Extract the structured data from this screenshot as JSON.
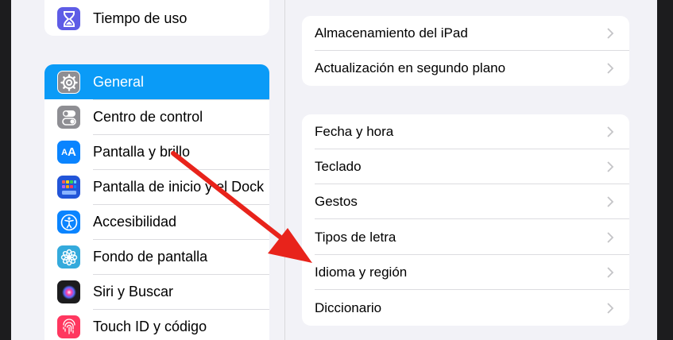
{
  "sidebar": {
    "top_item": {
      "label": "Tiempo de uso",
      "icon": "hourglass-icon",
      "color": "#5e5ce6"
    },
    "items": [
      {
        "label": "General",
        "icon": "gear-icon",
        "color": "#8e8e93",
        "selected": true
      },
      {
        "label": "Centro de control",
        "icon": "toggles-icon",
        "color": "#8e8e93"
      },
      {
        "label": "Pantalla y brillo",
        "icon": "text-size-icon",
        "color": "#0a84ff"
      },
      {
        "label": "Pantalla de inicio y el Dock",
        "icon": "app-grid-icon",
        "color": "#2255d8"
      },
      {
        "label": "Accesibilidad",
        "icon": "accessibility-icon",
        "color": "#0a84ff"
      },
      {
        "label": "Fondo de pantalla",
        "icon": "flower-icon",
        "color": "#34aadc"
      },
      {
        "label": "Siri y Buscar",
        "icon": "siri-icon",
        "color": "#1c1c1e"
      },
      {
        "label": "Touch ID y código",
        "icon": "fingerprint-icon",
        "color": "#ff375f"
      }
    ]
  },
  "detail": {
    "group1": [
      {
        "label": "Almacenamiento del iPad"
      },
      {
        "label": "Actualización en segundo plano"
      }
    ],
    "group2": [
      {
        "label": "Fecha y hora"
      },
      {
        "label": "Teclado"
      },
      {
        "label": "Gestos"
      },
      {
        "label": "Tipos de letra"
      },
      {
        "label": "Idioma y región"
      },
      {
        "label": "Diccionario"
      }
    ]
  },
  "annotation": {
    "color": "#e8231b"
  }
}
